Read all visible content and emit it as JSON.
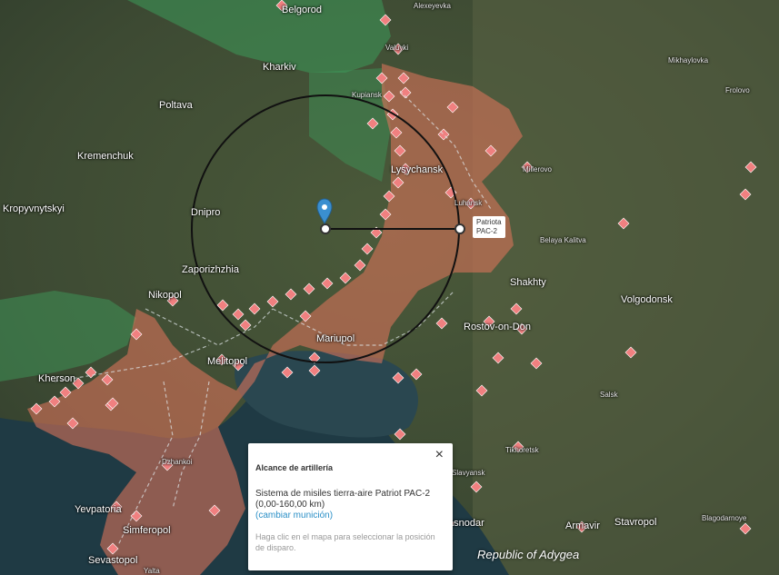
{
  "map": {
    "cities": [
      {
        "id": "belgorod",
        "name": "Belgorod"
      },
      {
        "id": "alexeyevka",
        "name": "Alexeyevka"
      },
      {
        "id": "valuyki",
        "name": "Valuyki"
      },
      {
        "id": "kharkiv",
        "name": "Kharkiv"
      },
      {
        "id": "kupiansk",
        "name": "Kupiansk"
      },
      {
        "id": "mikhaylovka",
        "name": "Mikhaylovka"
      },
      {
        "id": "frolovo",
        "name": "Frolovo"
      },
      {
        "id": "poltava",
        "name": "Poltava"
      },
      {
        "id": "kremenchuk",
        "name": "Kremenchuk"
      },
      {
        "id": "lysychansk",
        "name": "Lysychansk"
      },
      {
        "id": "millerovo",
        "name": "Millerovo"
      },
      {
        "id": "kropyvnytskyi",
        "name": "Kropyvnytskyi"
      },
      {
        "id": "dnipro",
        "name": "Dnipro"
      },
      {
        "id": "luhansk",
        "name": "Luhansk"
      },
      {
        "id": "belaya",
        "name": "Belaya Kalitva"
      },
      {
        "id": "zaporizhzhia",
        "name": "Zaporizhzhia"
      },
      {
        "id": "shakhty",
        "name": "Shakhty"
      },
      {
        "id": "nikopol",
        "name": "Nikopol"
      },
      {
        "id": "volgodonsk",
        "name": "Volgodonsk"
      },
      {
        "id": "rostov",
        "name": "Rostov-on-Don"
      },
      {
        "id": "mariupol",
        "name": "Mariupol"
      },
      {
        "id": "melitopol",
        "name": "Melitopol"
      },
      {
        "id": "kherson",
        "name": "Kherson"
      },
      {
        "id": "salsk",
        "name": "Salsk"
      },
      {
        "id": "dzhankoi",
        "name": "Dzhankoi"
      },
      {
        "id": "tikhoretsk",
        "name": "Tikhoretsk"
      },
      {
        "id": "yevpatoria",
        "name": "Yevpatoria"
      },
      {
        "id": "simferopol",
        "name": "Simferopol"
      },
      {
        "id": "krasnodar",
        "name": "Krasnodar"
      },
      {
        "id": "armavir",
        "name": "Armavir"
      },
      {
        "id": "stavropol",
        "name": "Stavropol"
      },
      {
        "id": "blagodarnoye",
        "name": "Blagodarnoye"
      },
      {
        "id": "sevastopol",
        "name": "Sevastopol"
      },
      {
        "id": "yalta",
        "name": "Yalta"
      },
      {
        "id": "slavyansk",
        "name": "Slavyansk"
      }
    ],
    "region_label": "Republic of Adygea",
    "marker_label_line1": "Patriota",
    "marker_label_line2": "PAC-2",
    "range_km": 160,
    "colors": {
      "occupied": "#d9735a",
      "ukraine_green": "#3d9a5a",
      "strike_marker": "#f08080",
      "range_circle": "#111111",
      "pin": "#3a8fd0"
    }
  },
  "popup": {
    "title": "Alcance de artillería",
    "description": "Sistema de misiles tierra-aire Patriot PAC-2 (0,00-160,00 km)",
    "change_link": "(cambiar munición)",
    "hint": "Haga clic en el mapa para seleccionar la posición de disparo.",
    "close_label": "×"
  }
}
